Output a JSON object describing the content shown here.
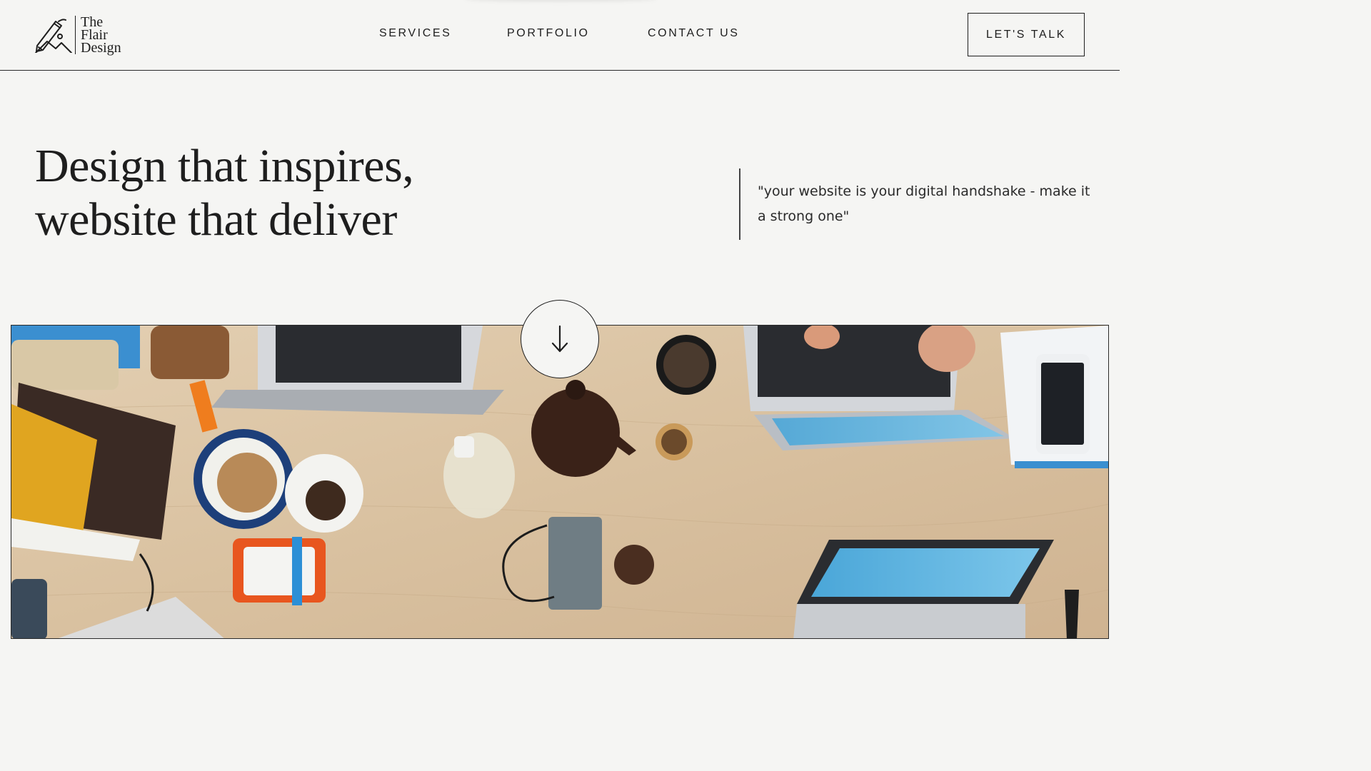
{
  "brand": {
    "logo_lines": [
      "The",
      "Flair",
      "Design"
    ],
    "logo_icon": "pencil-mountain-icon"
  },
  "nav": {
    "items": [
      {
        "label": "SERVICES"
      },
      {
        "label": "PORTFOLIO"
      },
      {
        "label": "CONTACT US"
      }
    ],
    "cta_label": "LET'S TALK"
  },
  "hero": {
    "title_lines": [
      "Design that inspires,",
      "website that deliver"
    ],
    "quote": "\"your website is your digital handshake - make it a strong one\""
  },
  "scroll_button": {
    "icon": "arrow-down-icon"
  },
  "hero_image": {
    "subject": "overhead photo of a wooden desk with laptops, teapot, snacks and gadgets"
  },
  "colors": {
    "background": "#f5f5f3",
    "text": "#1e1e1e",
    "border": "#2a2a2a"
  }
}
